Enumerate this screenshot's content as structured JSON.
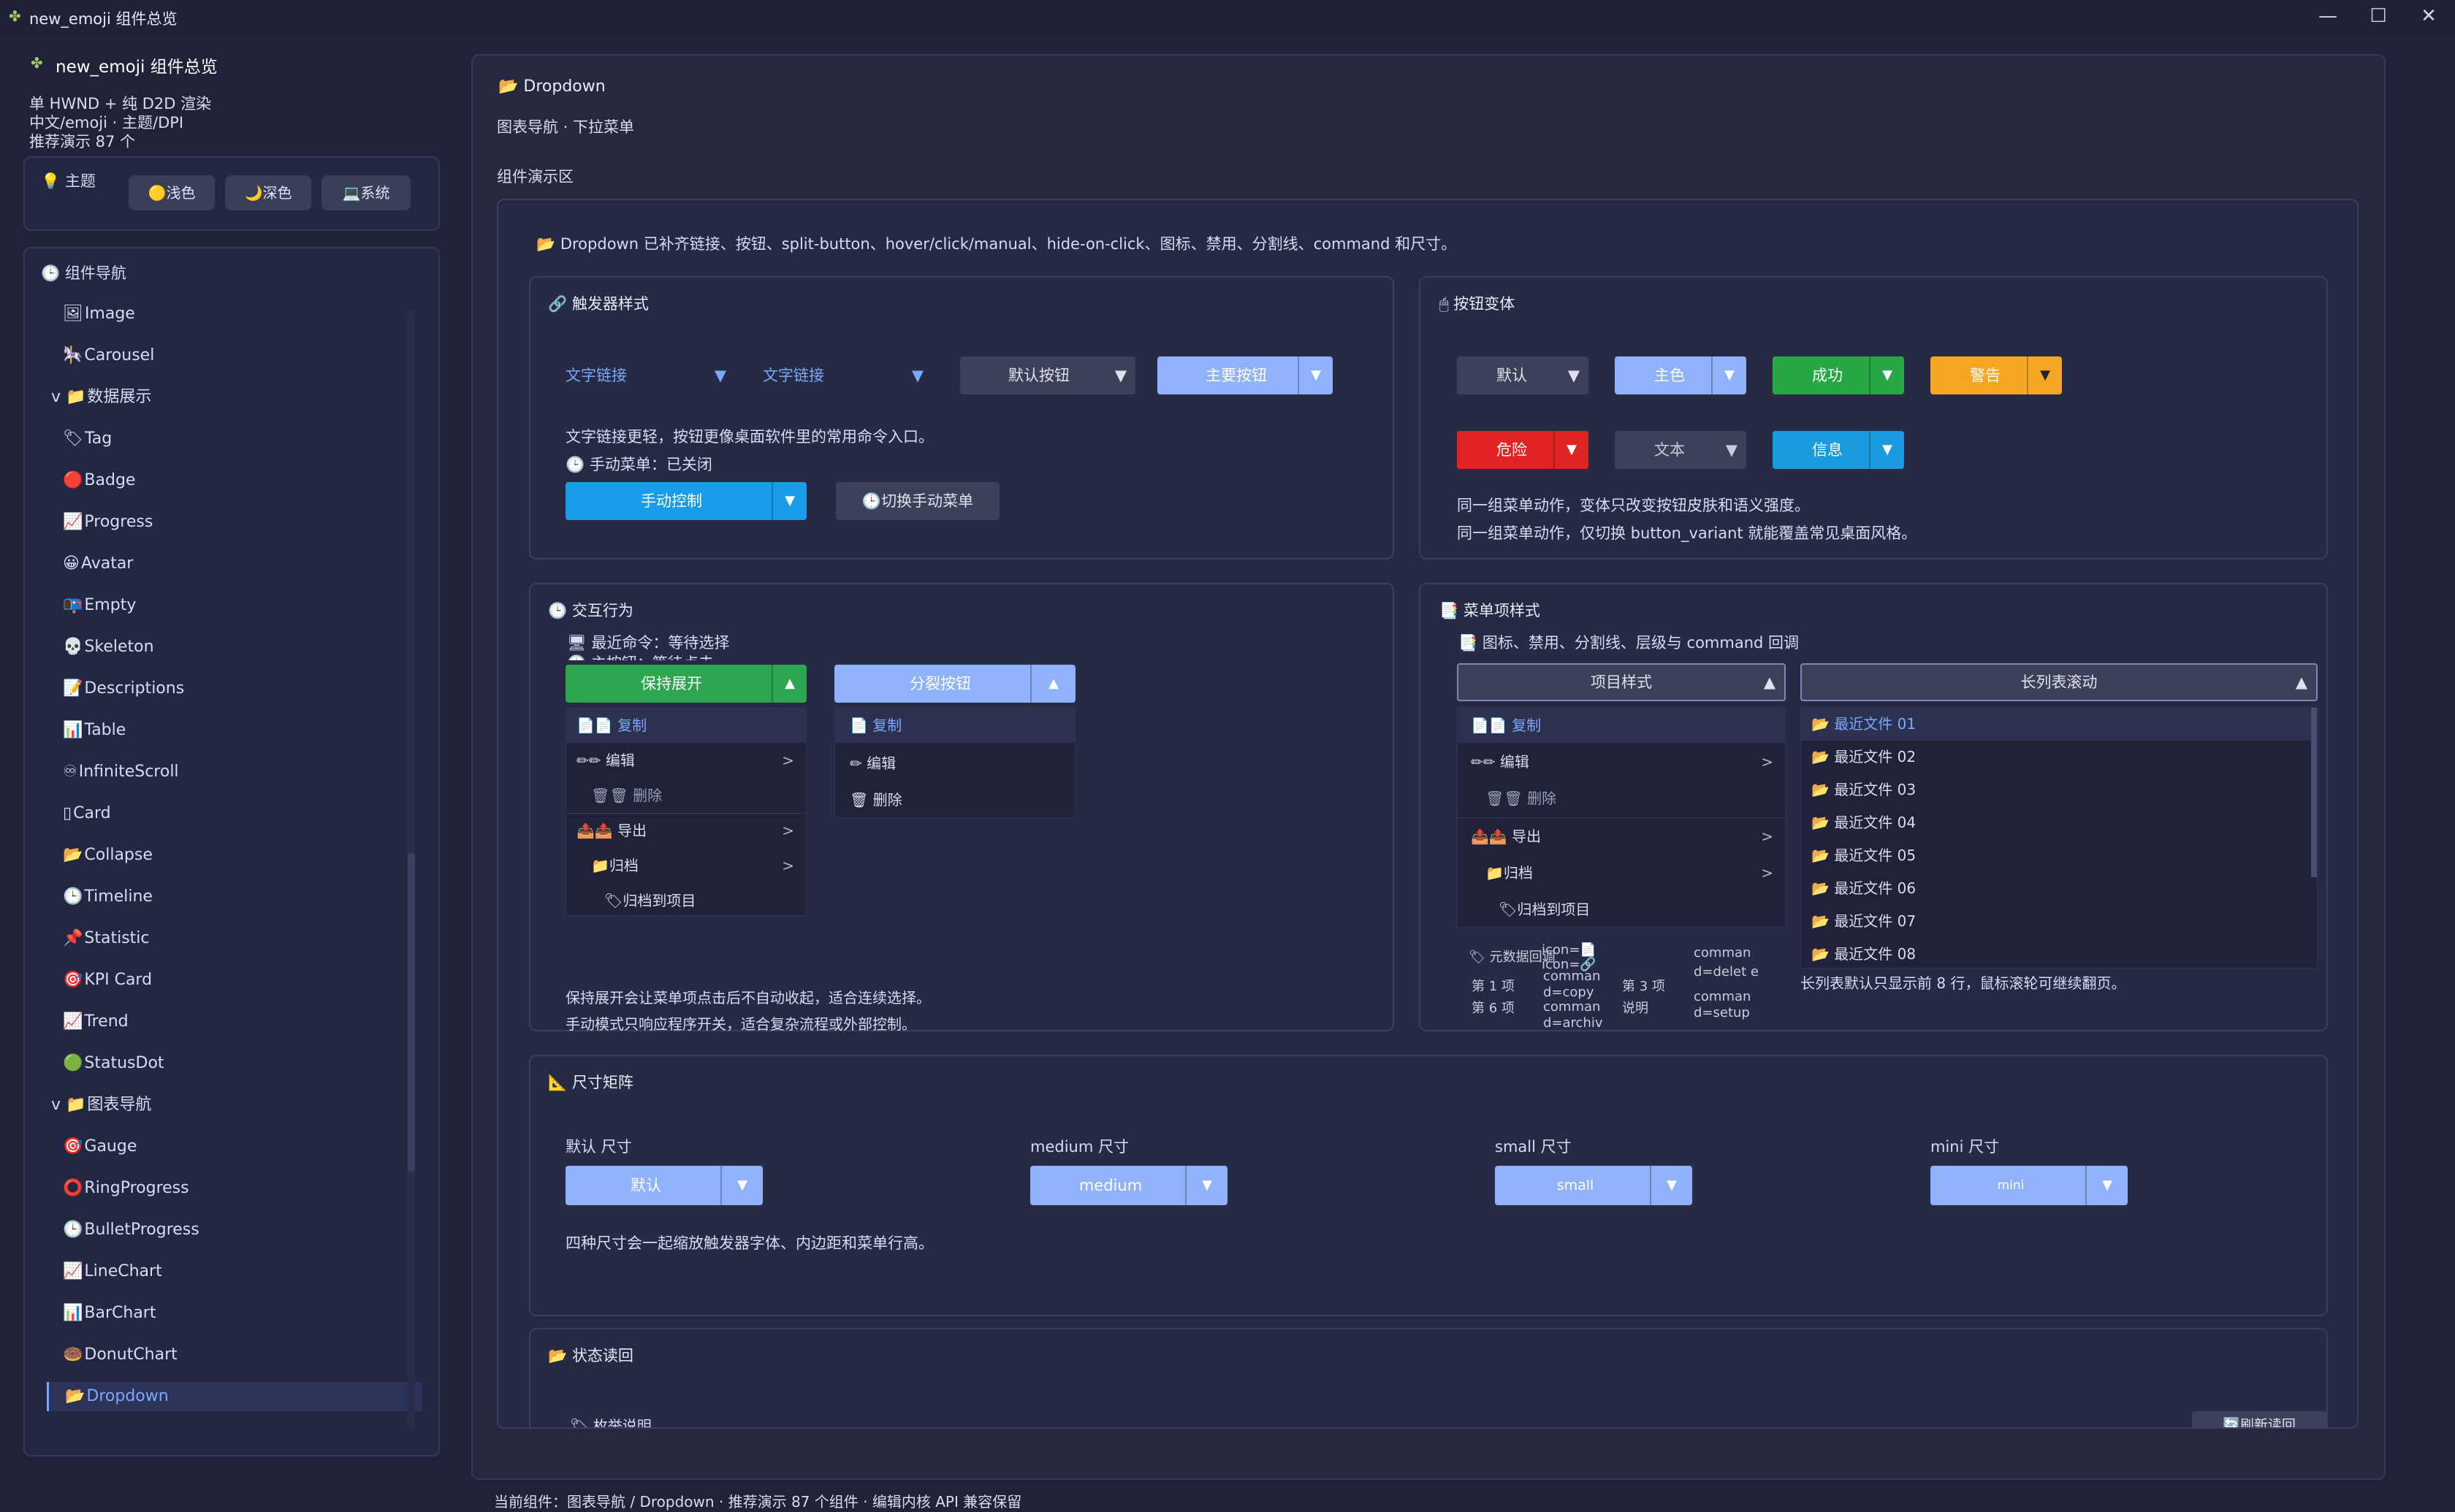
{
  "window": {
    "title": "new_emoji 组件总览",
    "controls": [
      "—",
      "☐",
      "✕"
    ]
  },
  "sidebar": {
    "app_title": "new_emoji 组件总览",
    "meta": [
      "单 HWND + 纯 D2D 渲染",
      "中文/emoji · 主题/DPI",
      "推荐演示 87 个"
    ],
    "theme": {
      "label": "主题",
      "options": [
        "浅色",
        "深色",
        "系统"
      ]
    },
    "nav_title": "组件导航",
    "items": [
      {
        "icon": "🖼",
        "label": "Image"
      },
      {
        "icon": "🎠",
        "label": "Carousel"
      },
      {
        "icon": "v 📁",
        "label": "数据展示",
        "group": true
      },
      {
        "icon": "🏷",
        "label": "Tag"
      },
      {
        "icon": "🔴",
        "label": "Badge"
      },
      {
        "icon": "📈",
        "label": "Progress"
      },
      {
        "icon": "😀",
        "label": "Avatar"
      },
      {
        "icon": "📭",
        "label": "Empty"
      },
      {
        "icon": "💀",
        "label": "Skeleton"
      },
      {
        "icon": "📝",
        "label": "Descriptions"
      },
      {
        "icon": "📊",
        "label": "Table"
      },
      {
        "icon": "♾",
        "label": "InfiniteScroll"
      },
      {
        "icon": "▯",
        "label": "Card"
      },
      {
        "icon": "📂",
        "label": "Collapse"
      },
      {
        "icon": "🕒",
        "label": "Timeline"
      },
      {
        "icon": "📌",
        "label": "Statistic"
      },
      {
        "icon": "🎯",
        "label": "KPI Card"
      },
      {
        "icon": "📈",
        "label": "Trend"
      },
      {
        "icon": "🟢",
        "label": "StatusDot"
      },
      {
        "icon": "v 📁",
        "label": "图表导航",
        "group": true
      },
      {
        "icon": "🎯",
        "label": "Gauge"
      },
      {
        "icon": "⭕",
        "label": "RingProgress"
      },
      {
        "icon": "🕒",
        "label": "BulletProgress"
      },
      {
        "icon": "📈",
        "label": "LineChart"
      },
      {
        "icon": "📊",
        "label": "BarChart"
      },
      {
        "icon": "🍩",
        "label": "DonutChart"
      },
      {
        "icon": "📂",
        "label": "Dropdown",
        "active": true
      }
    ]
  },
  "main": {
    "title": "Dropdown",
    "subtitle": "图表导航 · 下拉菜单",
    "section": "组件演示区",
    "intro": "Dropdown 已补齐链接、按钮、split-button、hover/click/manual、hide-on-click、图标、禁用、分割线、command 和尺寸。",
    "trigger_card": {
      "title": "触发器样式",
      "triggers": [
        "文字链接",
        "文字链接",
        "默认按钮",
        "主要按钮"
      ],
      "desc": "文字链接更轻，按钮更像桌面软件里的常用命令入口。",
      "manual_state": "手动菜单：已关闭",
      "manual_button": "手动控制",
      "toggle_button": "切换手动菜单"
    },
    "variant_card": {
      "title": "按钮变体",
      "row1": [
        "默认",
        "主色",
        "成功",
        "警告"
      ],
      "row2": [
        "危险",
        "文本",
        "信息"
      ],
      "desc1": "同一组菜单动作，变体只改变按钮皮肤和语义强度。",
      "desc2": "同一组菜单动作，仅切换 button_variant 就能覆盖常见桌面风格。"
    },
    "interaction_card": {
      "title": "交互行为",
      "recent": "最近命令：等待选择",
      "hidden_line": "主按钮：等待点击",
      "keep_open": "保持展开",
      "split": "分裂按钮",
      "menu1": [
        "复制",
        "编辑",
        "删除",
        "导出",
        "归档",
        "归档到项目"
      ],
      "menu2": [
        "复制",
        "编辑",
        "删除"
      ],
      "desc1": "保持展开会让菜单项点击后不自动收起，适合连续选择。",
      "desc2": "手动模式只响应程序开关，适合复杂流程或外部控制。"
    },
    "item_card": {
      "title": "菜单项样式",
      "subtitle": "图标、禁用、分割线、层级与 command 回调",
      "item_style": "项目样式",
      "long_list": "长列表滚动",
      "menu": [
        "复制",
        "编辑",
        "删除",
        "导出",
        "归档",
        "归档到项目"
      ],
      "files": [
        "最近文件 01",
        "最近文件 02",
        "最近文件 03",
        "最近文件 04",
        "最近文件 05",
        "最近文件 06",
        "最近文件 07",
        "最近文件 08"
      ],
      "meta_label": "元数据回调",
      "overlap_texts": [
        "icon=📄",
        "icon=🔗",
        "comman d=delet e",
        "comman d=copy",
        "comman d=archiv",
        "第 1 项",
        "第 3 项",
        "第 6 项",
        "说明",
        "comman d=setup"
      ],
      "long_desc": "长列表默认只显示前 8 行，鼠标滚轮可继续翻页。"
    },
    "size_card": {
      "title": "尺寸矩阵",
      "labels": [
        "默认 尺寸",
        "medium 尺寸",
        "small 尺寸",
        "mini 尺寸"
      ],
      "buttons": [
        "默认",
        "medium",
        "small",
        "mini"
      ],
      "desc": "四种尺寸会一起缩放触发器字体、内边距和菜单行高。"
    },
    "state_card": {
      "title": "状态读回",
      "partial_left": "枚举说明",
      "partial_right": "刷新读回"
    }
  },
  "status_bar": "当前组件：图表导航 / Dropdown · 推荐演示 87 个组件 · 编辑内核 API 兼容保留",
  "colors": {
    "primary": "#8fb2fb",
    "success": "#28a745",
    "warning": "#f5a623",
    "danger": "#e02424",
    "info": "#1a9be0",
    "manual": "#199ce9",
    "keep_open": "#2ea54f"
  }
}
